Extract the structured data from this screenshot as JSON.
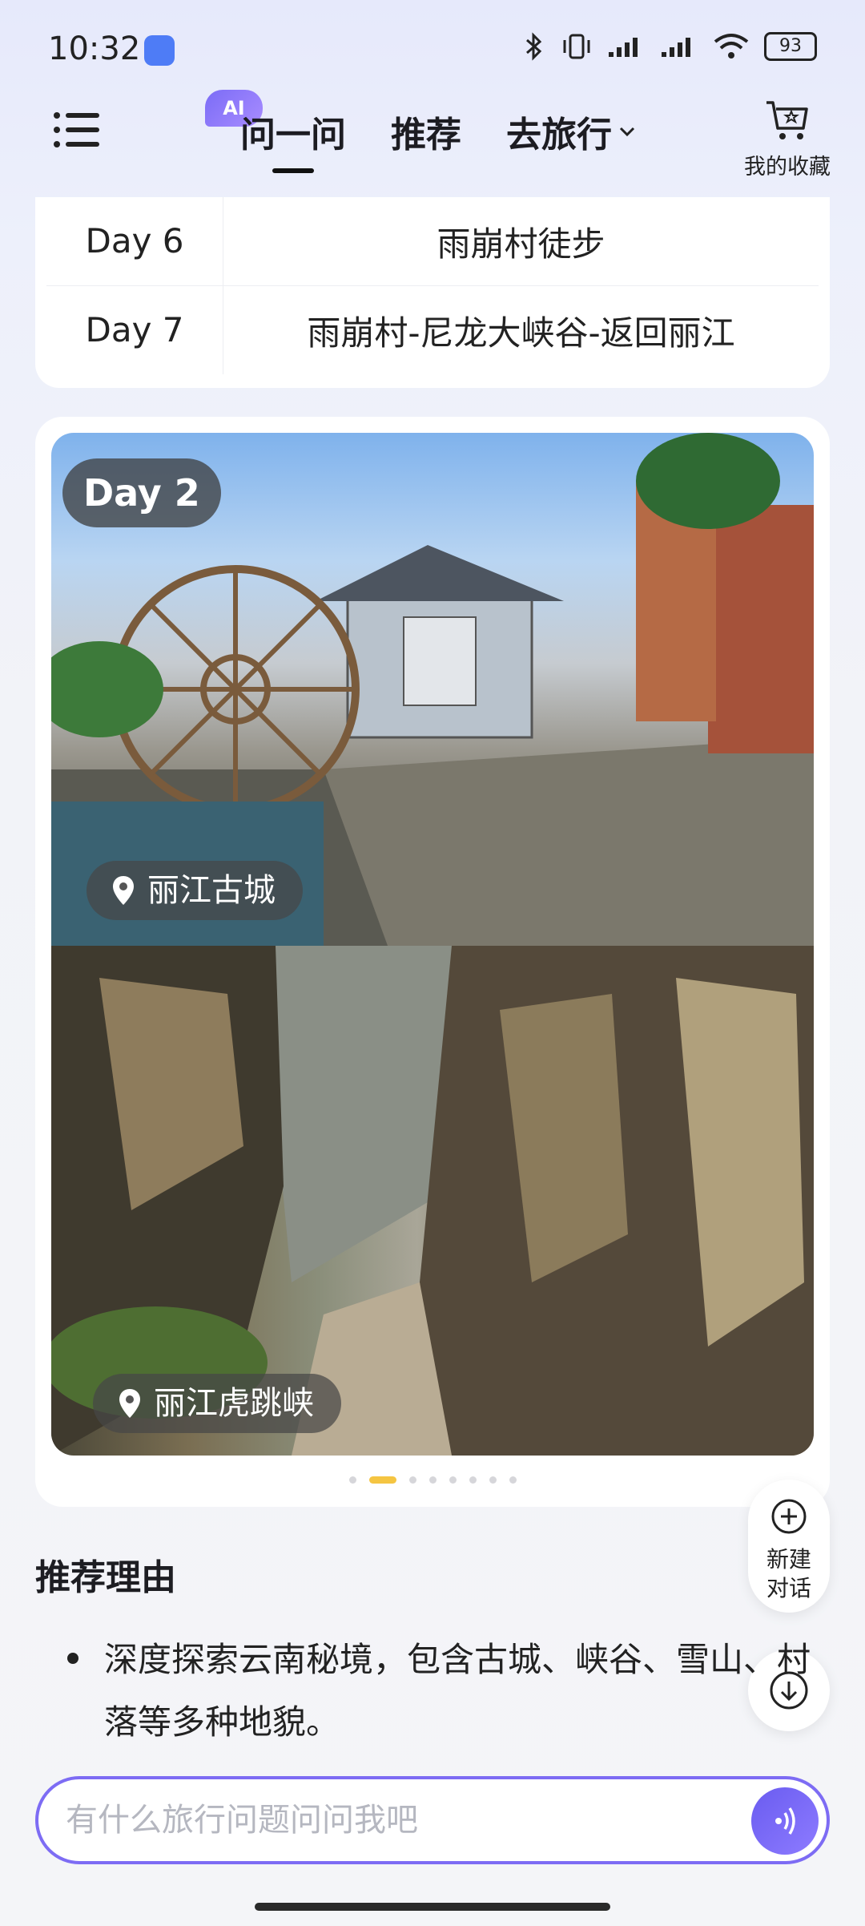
{
  "status_bar": {
    "time": "10:32",
    "battery": "93"
  },
  "nav": {
    "ai_badge": "AI",
    "tabs": [
      {
        "label": "问一问"
      },
      {
        "label": "推荐"
      },
      {
        "label": "去旅行"
      }
    ],
    "favorites_label": "我的收藏"
  },
  "itinerary": {
    "rows": [
      {
        "day": "Day 6",
        "plan": "雨崩村徒步"
      },
      {
        "day": "Day 7",
        "plan": "雨崩村-尼龙大峡谷-返回丽江"
      }
    ]
  },
  "gallery": {
    "day_chip": "Day 2",
    "photos": [
      {
        "location": "丽江古城"
      },
      {
        "location": "丽江虎跳峡"
      }
    ],
    "page_count": 8,
    "active_page": 2
  },
  "floating": {
    "new_chat_line1": "新建",
    "new_chat_line2": "对话"
  },
  "recommendation": {
    "title": "推荐理由",
    "bullets": [
      "深度探索云南秘境，包含古城、峡谷、雪山、村落等多种地貌。"
    ]
  },
  "input": {
    "placeholder": "有什么旅行问题问问我吧"
  }
}
